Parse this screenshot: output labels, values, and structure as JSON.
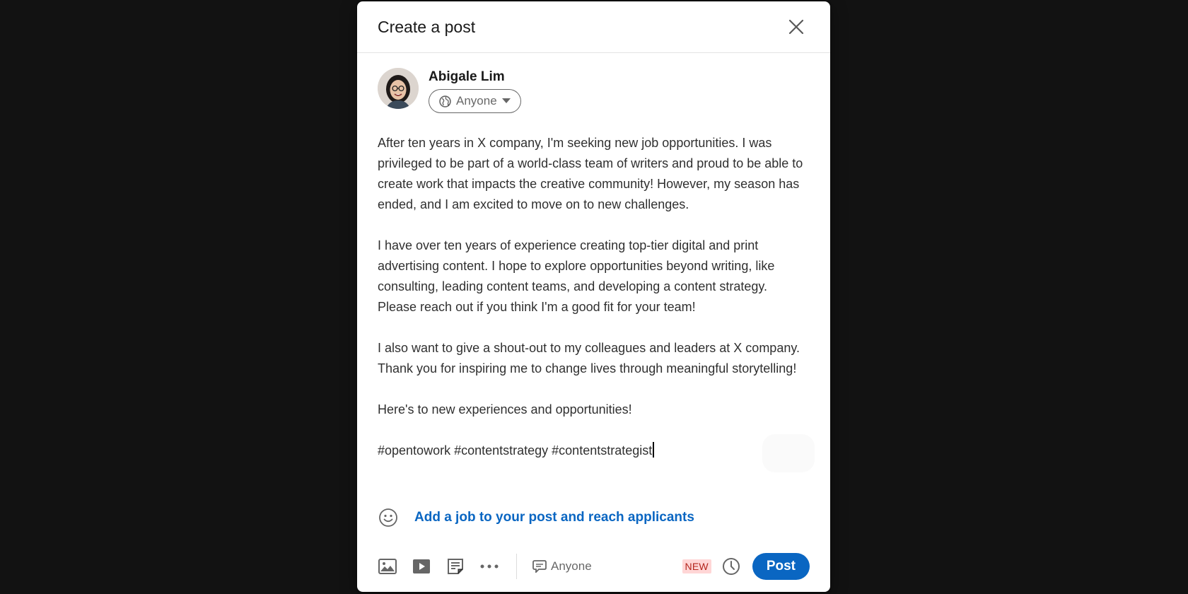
{
  "dialog": {
    "title": "Create a post"
  },
  "author": {
    "name": "Abigale Lim",
    "audience_label": "Anyone"
  },
  "editor": {
    "paragraphs": [
      "After ten years in X company, I'm seeking new job opportunities. I was privileged to be part of a world-class team of writers and proud to be able to create work that impacts the creative community! However, my season has ended, and I am excited to move on to new challenges.",
      "I have over ten years of experience creating top-tier digital and print advertising content. I hope to explore opportunities beyond writing, like consulting, leading content teams, and developing a content strategy. Please reach out if you think I'm a good fit for your team!",
      "I also want to give a shout-out to my colleagues and leaders at X company. Thank you for inspiring me to change lives through meaningful storytelling!",
      "Here's to new experiences and opportunities!",
      "#opentowork #contentstrategy #contentstrategist"
    ]
  },
  "job_prompt": {
    "label": "Add a job to your post and reach applicants"
  },
  "footer": {
    "comment_control_label": "Anyone",
    "new_badge": "NEW",
    "post_label": "Post"
  },
  "icons": {
    "close": "close-icon",
    "globe": "globe-icon",
    "caret": "caret-down-icon",
    "emoji": "emoji-icon",
    "photo": "image-icon",
    "video": "video-icon",
    "document": "document-icon",
    "more": "more-icon",
    "comment": "comment-icon",
    "schedule": "clock-icon"
  },
  "colors": {
    "accent": "#0a66c2",
    "new_badge_bg": "#ffd6d6",
    "new_badge_text": "#b3261e"
  }
}
